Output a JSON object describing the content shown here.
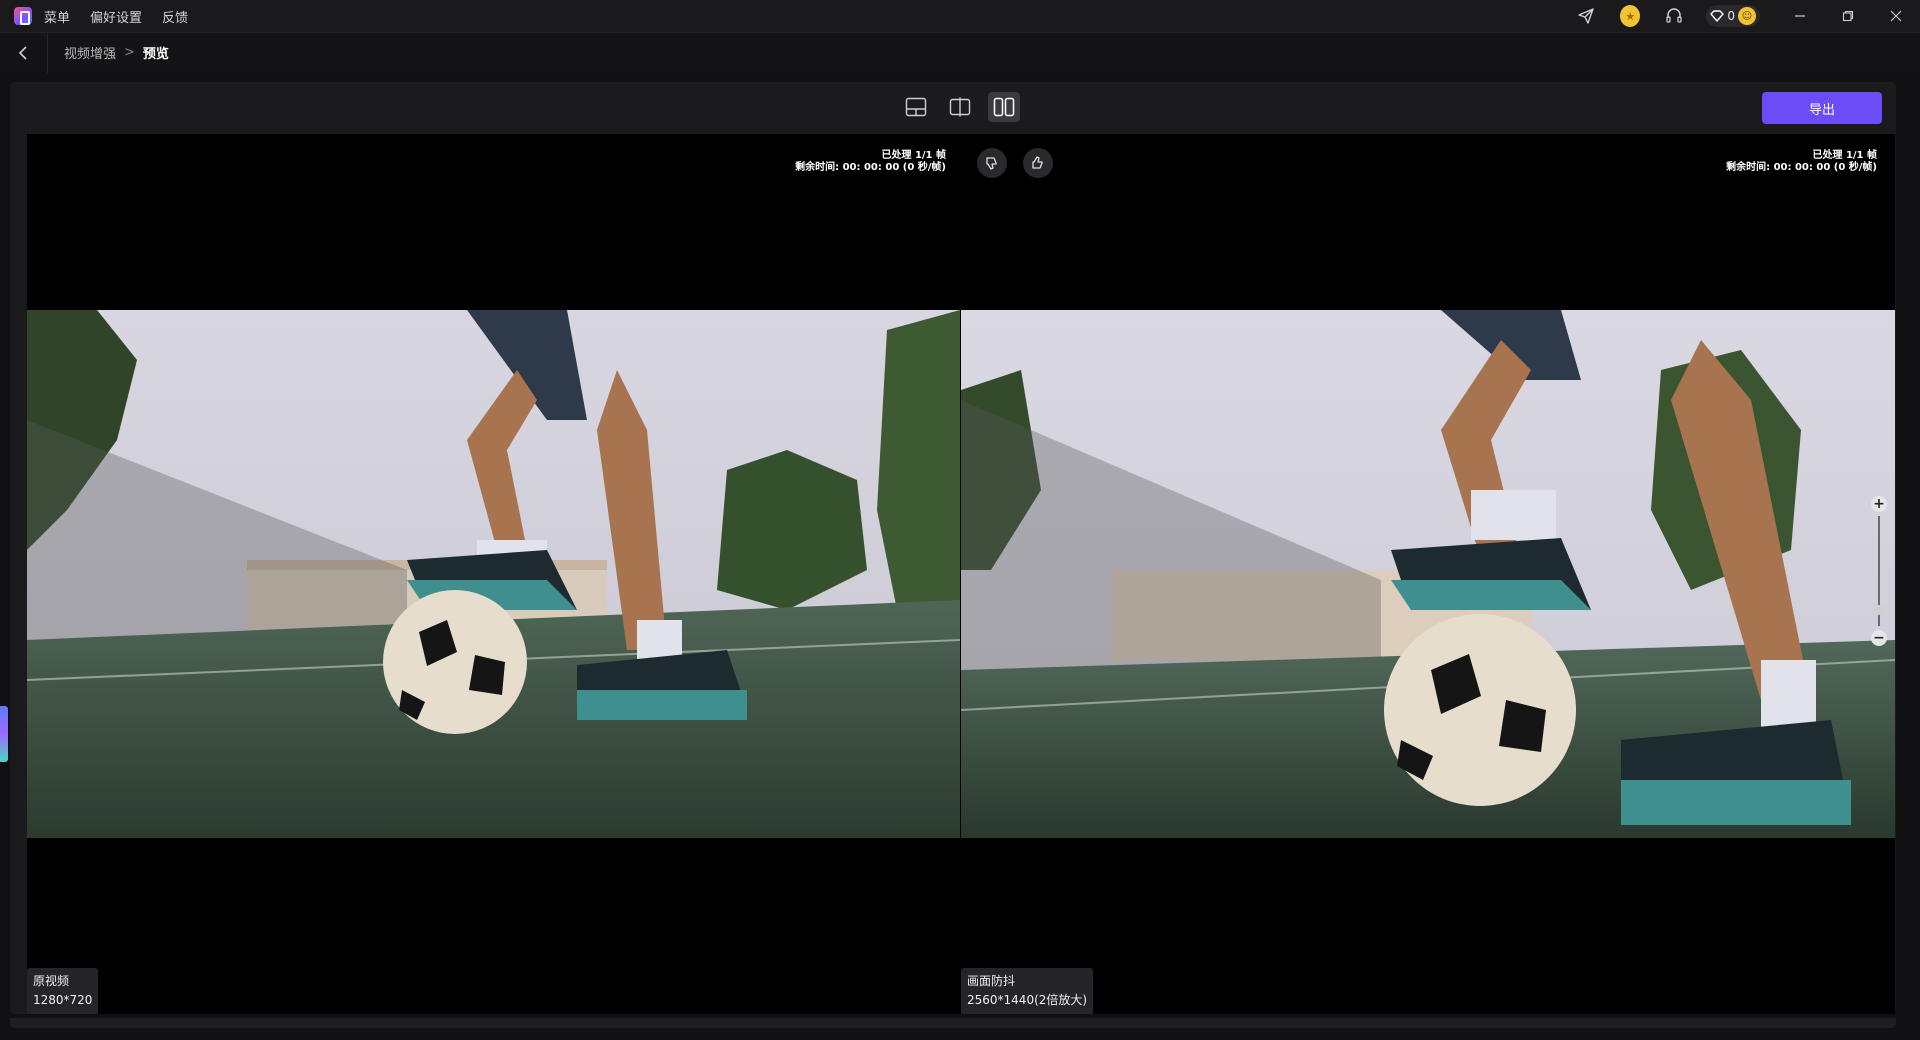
{
  "titlebar": {
    "menu": [
      "菜单",
      "偏好设置",
      "反馈"
    ],
    "gem_count": "0"
  },
  "navbar": {
    "breadcrumb_parent": "视频增强",
    "breadcrumb_separator": ">",
    "breadcrumb_current": "预览"
  },
  "toolbar": {
    "export_label": "导出",
    "view_modes": [
      "bottom-split-icon",
      "compare-slider-icon",
      "side-by-side-icon"
    ],
    "active_mode_index": 2
  },
  "left_pane": {
    "progress_line1": "已处理 1/1 帧",
    "progress_line2": "剩余时间: 00: 00: 00 (0 秒/帧)",
    "label_name": "原视频",
    "label_resolution": "1280*720"
  },
  "right_pane": {
    "progress_line1": "已处理 1/1 帧",
    "progress_line2": "剩余时间: 00: 00: 00 (0 秒/帧)",
    "label_name": "画面防抖",
    "label_resolution": "2560*1440(2倍放大)"
  },
  "zoom": {
    "plus": "+",
    "minus": "−",
    "level": 0.15
  },
  "colors": {
    "accent": "#6b4cf6",
    "background": "#111114",
    "panel": "#1b1b1e"
  }
}
